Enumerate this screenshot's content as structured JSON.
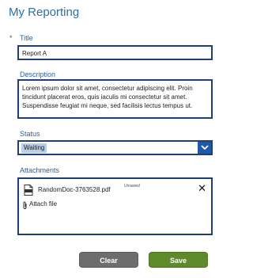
{
  "header": {
    "title": "My Reporting"
  },
  "form": {
    "title_field": {
      "required_marker": "*",
      "label": "Title",
      "value": "Report A"
    },
    "description_field": {
      "label": "Description",
      "value": "Lorem ipsum dolor sit amet, consectetur adipiscing elit. Proin tincidunt placerat eros, quis iaculis mi consectetur sit amet. Suspendisse feugiat mi neque, sed facilisis lectus tempus ut."
    },
    "status_field": {
      "label": "Status",
      "selected": "Waiting"
    },
    "attachments_field": {
      "label": "Attachments",
      "files": [
        {
          "name": "RandomDoc-3763528.pdf",
          "state": "Unsaved"
        }
      ],
      "attach_label": "Attach file"
    }
  },
  "actions": {
    "clear_label": "Clear",
    "save_label": "Save"
  },
  "colors": {
    "accent": "#2e6fa8",
    "border": "#1f3f7a",
    "save": "#5f8a2c",
    "clear": "#6d6d6d"
  }
}
